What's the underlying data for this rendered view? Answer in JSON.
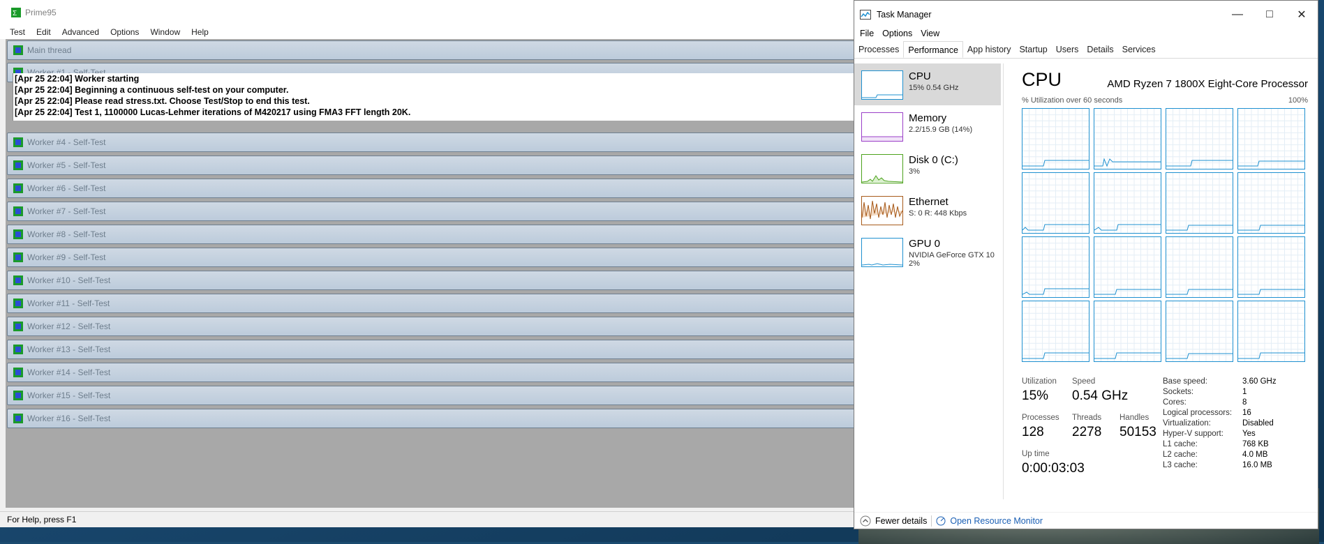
{
  "prime95": {
    "title": "Prime95",
    "menu": [
      "Test",
      "Edit",
      "Advanced",
      "Options",
      "Window",
      "Help"
    ],
    "main_thread": "Main thread",
    "worker_open": {
      "title": "Worker #1 - Self-Test",
      "log": [
        "[Apr 25 22:04] Worker starting",
        "[Apr 25 22:04] Beginning a continuous self-test on your computer.",
        "[Apr 25 22:04] Please read stress.txt.  Choose Test/Stop to end this test.",
        "[Apr 25 22:04] Test 1, 1100000 Lucas-Lehmer iterations of M420217 using FMA3 FFT length 20K."
      ]
    },
    "workers": [
      "Worker #4 - Self-Test",
      "Worker #5 - Self-Test",
      "Worker #6 - Self-Test",
      "Worker #7 - Self-Test",
      "Worker #8 - Self-Test",
      "Worker #9 - Self-Test",
      "Worker #10 - Self-Test",
      "Worker #11 - Self-Test",
      "Worker #12 - Self-Test",
      "Worker #13 - Self-Test",
      "Worker #14 - Self-Test",
      "Worker #15 - Self-Test",
      "Worker #16 - Self-Test"
    ],
    "status": "For Help, press F1"
  },
  "taskmanager": {
    "title": "Task Manager",
    "menu": [
      "File",
      "Options",
      "View"
    ],
    "tabs": [
      "Processes",
      "Performance",
      "App history",
      "Startup",
      "Users",
      "Details",
      "Services"
    ],
    "active_tab": "Performance",
    "sidebar": [
      {
        "name": "CPU",
        "sub": "15%  0.54 GHz",
        "sub2": "",
        "color": "#1e90d0"
      },
      {
        "name": "Memory",
        "sub": "2.2/15.9 GB (14%)",
        "sub2": "",
        "color": "#9b3fc8"
      },
      {
        "name": "Disk 0 (C:)",
        "sub": "3%",
        "sub2": "",
        "color": "#4ca21c"
      },
      {
        "name": "Ethernet",
        "sub": "S: 0  R: 448 Kbps",
        "sub2": "",
        "color": "#a75a1a"
      },
      {
        "name": "GPU 0",
        "sub": "NVIDIA GeForce GTX 10",
        "sub2": "2%",
        "color": "#1e90d0"
      }
    ],
    "detail": {
      "heading": "CPU",
      "processor": "AMD Ryzen 7 1800X Eight-Core Processor",
      "axis_left": "% Utilization over 60 seconds",
      "axis_right": "100%",
      "stats": {
        "utilization_label": "Utilization",
        "utilization": "15%",
        "speed_label": "Speed",
        "speed": "0.54 GHz",
        "processes_label": "Processes",
        "processes": "128",
        "threads_label": "Threads",
        "threads": "2278",
        "handles_label": "Handles",
        "handles": "50153",
        "uptime_label": "Up time",
        "uptime": "0:00:03:03"
      },
      "specs": [
        {
          "k": "Base speed:",
          "v": "3.60 GHz"
        },
        {
          "k": "Sockets:",
          "v": "1"
        },
        {
          "k": "Cores:",
          "v": "8"
        },
        {
          "k": "Logical processors:",
          "v": "16"
        },
        {
          "k": "Virtualization:",
          "v": "Disabled"
        },
        {
          "k": "Hyper-V support:",
          "v": "Yes"
        },
        {
          "k": "L1 cache:",
          "v": "768 KB"
        },
        {
          "k": "L2 cache:",
          "v": "4.0 MB"
        },
        {
          "k": "L3 cache:",
          "v": "16.0 MB"
        }
      ]
    },
    "footer": {
      "fewer": "Fewer details",
      "monitor": "Open Resource Monitor"
    }
  }
}
